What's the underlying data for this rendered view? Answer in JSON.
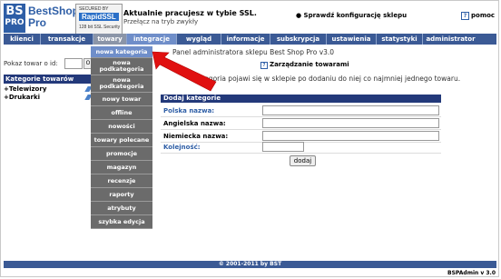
{
  "header": {
    "logo": {
      "mark_top": "BS",
      "mark_bottom": "PRO",
      "name_line1": "BestShop",
      "name_line2": "Pro"
    },
    "ssl_badge": {
      "line1": "SECURED BY",
      "brand": "RapidSSL",
      "line3": "128 bit SSL Security"
    },
    "ssl_line1": "Aktualnie pracujesz w tybie SSL.",
    "ssl_line2": "Przełącz na tryb zwykły",
    "check_config": "Sprawdź konfigurację sklepu",
    "help": "pomoc"
  },
  "nav": [
    {
      "label": "klienci"
    },
    {
      "label": "transakcje"
    },
    {
      "label": "towary"
    },
    {
      "label": "integracje"
    },
    {
      "label": "wygląd"
    },
    {
      "label": "informacje"
    },
    {
      "label": "subskrypcja"
    },
    {
      "label": "ustawienia"
    },
    {
      "label": "statystyki"
    },
    {
      "label": "administrator"
    }
  ],
  "panel_title": "Panel administratora sklepu Best Shop Pro v3.0",
  "left": {
    "show_product_label": "Pokaz towar o id:",
    "show_button": "O",
    "categories_header": "Kategorie towarów",
    "categories": [
      "Telewizory",
      "Drukarki"
    ]
  },
  "dropdown": [
    "nowa kategoria",
    "nowa podkategoria",
    "nowa podkategoria",
    "nowy towar",
    "offline",
    "nowości",
    "towary polecane",
    "promocje",
    "magazyn",
    "recenzje",
    "raporty",
    "atrybuty",
    "szybka edycja"
  ],
  "main": {
    "management_link": "Zarządzanie towarami",
    "info": "Kategoria pojawi się w sklepie po dodaniu do niej co najmniej jednego towaru.",
    "form_title": "Dodaj kategorie",
    "fields": [
      {
        "label": "Polska nazwa:",
        "value": ""
      },
      {
        "label": "Angielska nazwa:",
        "value": ""
      },
      {
        "label": "Niemiecka nazwa:",
        "value": ""
      },
      {
        "label": "Kolejność:",
        "value": ""
      }
    ],
    "submit_label": "dodaj"
  },
  "footer": {
    "copyright": "© 2001-2011 by BST",
    "version": "BSPAdmin v 3.0"
  },
  "colors": {
    "nav": "#3b5a95",
    "header_bar": "#23397a",
    "dropdown": "#6b6b6b",
    "highlight": "#6f8ec9",
    "arrow": "#e01010"
  }
}
